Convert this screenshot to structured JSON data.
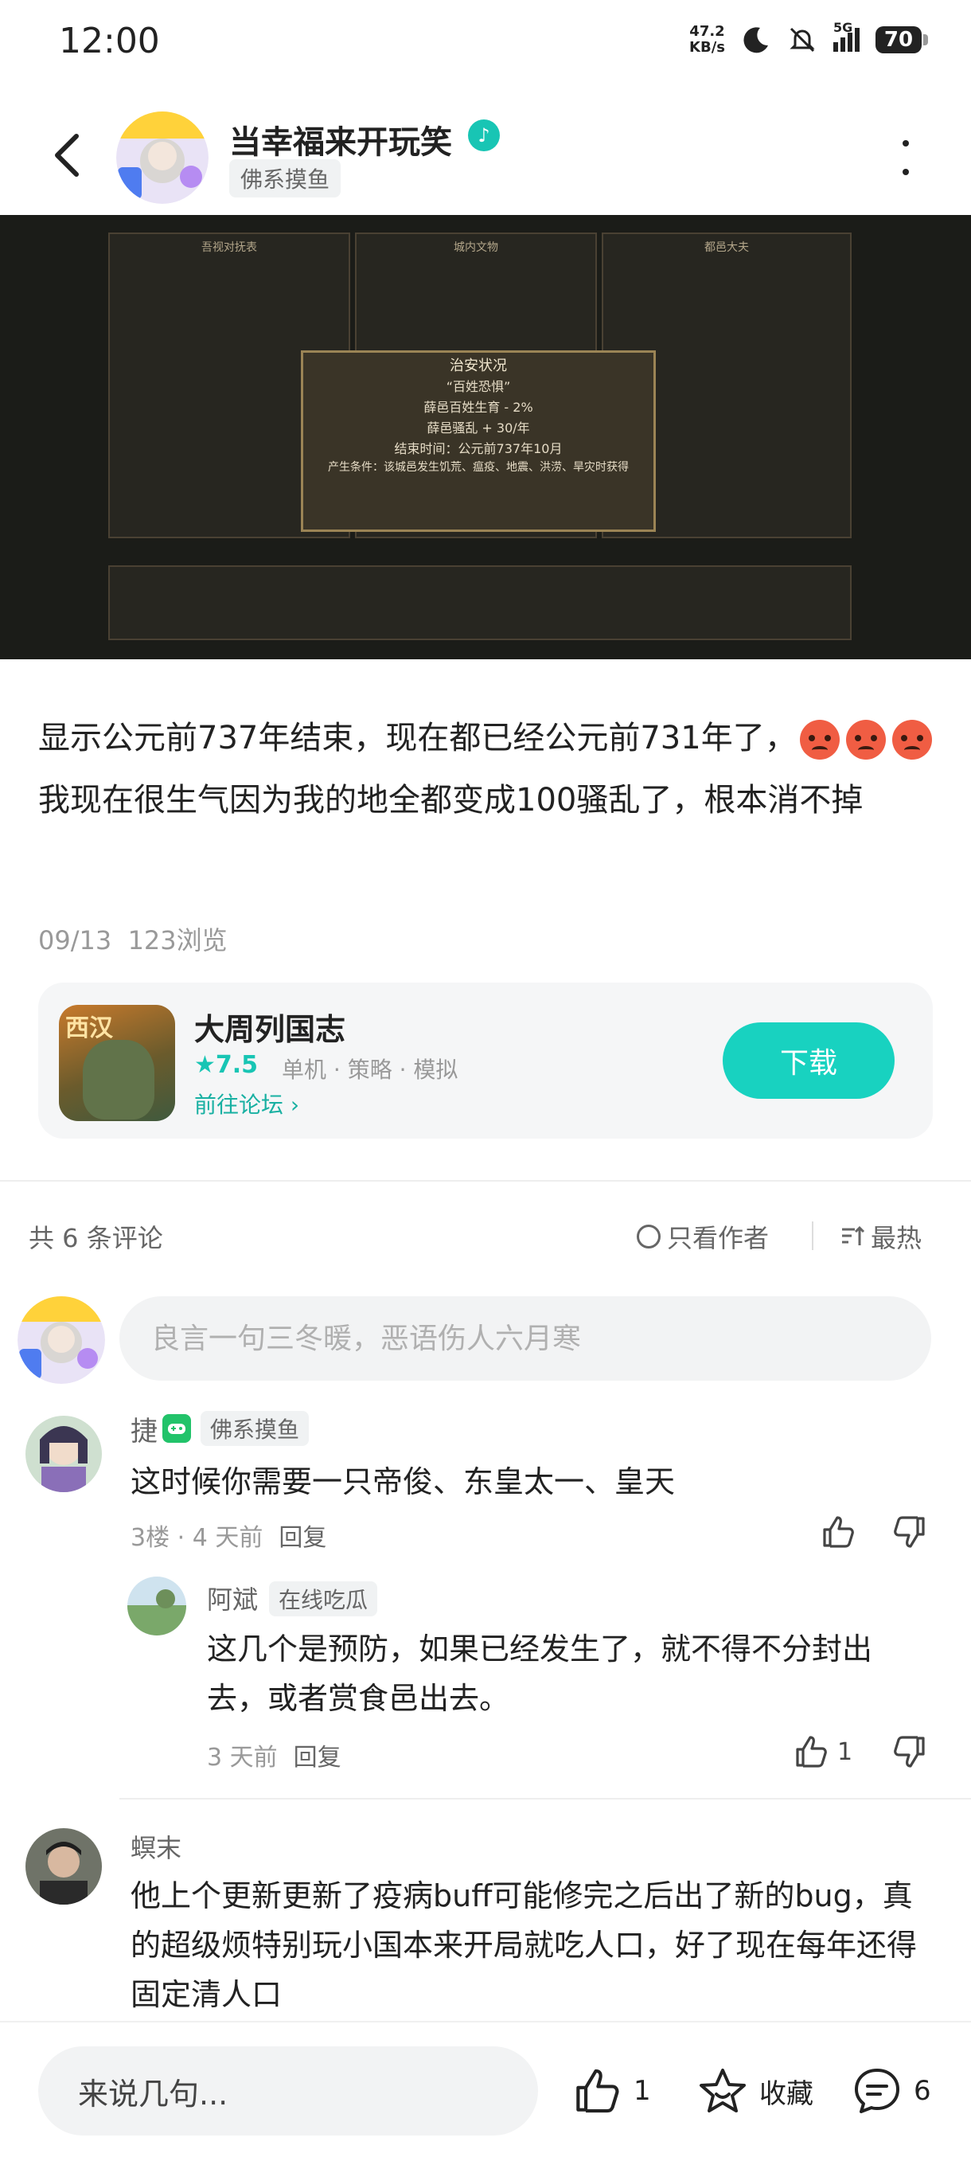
{
  "status_bar": {
    "time": "12:00",
    "net_speed_value": "47.2",
    "net_speed_unit": "KB/s",
    "network": "5G",
    "battery": "70"
  },
  "header": {
    "author_name": "当幸福来开玩笑",
    "author_tag": "佛系摸鱼",
    "icons": [
      "back-arrow",
      "verified-badge",
      "more-vertical"
    ]
  },
  "post_image": {
    "popup_title": "治安状况",
    "popup_lines": [
      "“百姓恐惧”",
      "薛邑百姓生育 - 2%",
      "薛邑骚乱 + 30/年",
      "结束时间：公元前737年10月",
      "产生条件：该城邑发生饥荒、瘟疫、地震、洪涝、旱灾时获得"
    ],
    "left_panel_title": "吾视对抚表",
    "center_panel_title": "城内文物",
    "right_panel_title": "都邑大夫"
  },
  "post": {
    "text_part1": "显示公元前737年结束，现在都已经公元前731年了，",
    "text_part2": "我现在很生气因为我的地全都变成100骚乱了，根本消不掉",
    "date": "09/13",
    "views": "123浏览"
  },
  "game_card": {
    "icon_text": "西汉",
    "title": "大周列国志",
    "rating": "★7.5",
    "tags": "单机 · 策略 · 模拟",
    "forum_link": "前往论坛 ›",
    "download_label": "下载"
  },
  "comments_header": {
    "count_label": "共 6 条评论",
    "only_author_label": "只看作者",
    "sort_label": "最热"
  },
  "comment_input": {
    "placeholder": "良言一句三冬暖，恶语伤人六月寒"
  },
  "comments": [
    {
      "name": "捷",
      "tag": "佛系摸鱼",
      "text": "这时候你需要一只帝俊、东皇太一、皇天",
      "meta": "3楼 · 4 天前",
      "reply_label": "回复",
      "replies": [
        {
          "name": "阿斌",
          "tag": "在线吃瓜",
          "text": "这几个是预防，如果已经发生了，就不得不分封出去，或者赏食邑出去。",
          "meta": "3 天前",
          "reply_label": "回复",
          "likes": "1"
        }
      ]
    },
    {
      "name": "螟末",
      "text": "他上个更新更新了疫病buff可能修完之后出了新的bug，真的超级烦特别玩小国本来开局就吃人口，好了现在每年还得固定清人口"
    }
  ],
  "bottom_bar": {
    "input_label": "来说几句...",
    "likes": "1",
    "collect_label": "收藏",
    "comments": "6"
  },
  "colors": {
    "accent": "#18d2c0",
    "text": "#222222",
    "muted": "#999999",
    "angry_emoji": "#f05d43"
  }
}
